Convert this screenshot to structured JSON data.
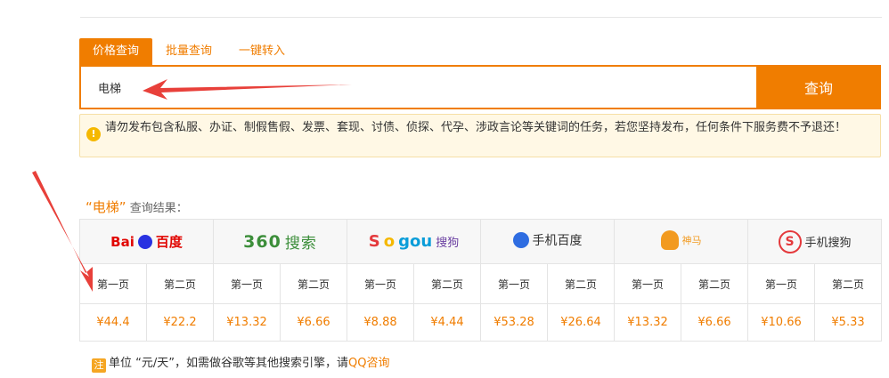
{
  "search": {
    "tabs": [
      "价格查询",
      "批量查询",
      "一键转入"
    ],
    "value": "电梯",
    "button_label": "查询"
  },
  "warning": {
    "icon": "exclamation-icon",
    "text": "请勿发布包含私服、办证、制假售假、发票、套现、讨债、侦探、代孕、涉政言论等关键词的任务，若您坚持发布，任何条件下服务费不予退还！"
  },
  "result": {
    "keyword": "“电梯”",
    "suffix": "查询结果："
  },
  "engines": [
    {
      "name": "百度",
      "pages": [
        "第一页",
        "第二页"
      ],
      "prices": [
        "¥44.4",
        "¥22.2"
      ]
    },
    {
      "name": "360搜索",
      "pages": [
        "第一页",
        "第二页"
      ],
      "prices": [
        "¥13.32",
        "¥6.66"
      ]
    },
    {
      "name": "搜狗",
      "pages": [
        "第一页",
        "第二页"
      ],
      "prices": [
        "¥8.88",
        "¥4.44"
      ]
    },
    {
      "name": "手机百度",
      "pages": [
        "第一页",
        "第二页"
      ],
      "prices": [
        "¥53.28",
        "¥26.64"
      ]
    },
    {
      "name": "神马",
      "pages": [
        "第一页",
        "第二页"
      ],
      "prices": [
        "¥13.32",
        "¥6.66"
      ]
    },
    {
      "name": "手机搜狗",
      "pages": [
        "第一页",
        "第二页"
      ],
      "prices": [
        "¥10.66",
        "¥5.33"
      ]
    }
  ],
  "logos": {
    "baidu": {
      "latin": "Bai",
      "cn": "百度"
    },
    "s360": {
      "num": "360",
      "cn": "搜索"
    },
    "sogou": {
      "latin_s": "S",
      "latin_o": "o",
      "latin_g": "gou",
      "cn": "搜狗"
    },
    "mbaidu": {
      "cn": "手机百度"
    },
    "shenma": {
      "cn": "神马"
    },
    "msogou": {
      "glyph": "S",
      "cn": "手机搜狗"
    }
  },
  "note": {
    "badge": "注",
    "text": "单位 “元/天”，如需做谷歌等其他搜索引擎，请",
    "link": "QQ咨询"
  },
  "colors": {
    "accent": "#f07d00",
    "warn_bg": "#fff8e5",
    "arrow": "#e8403a"
  }
}
